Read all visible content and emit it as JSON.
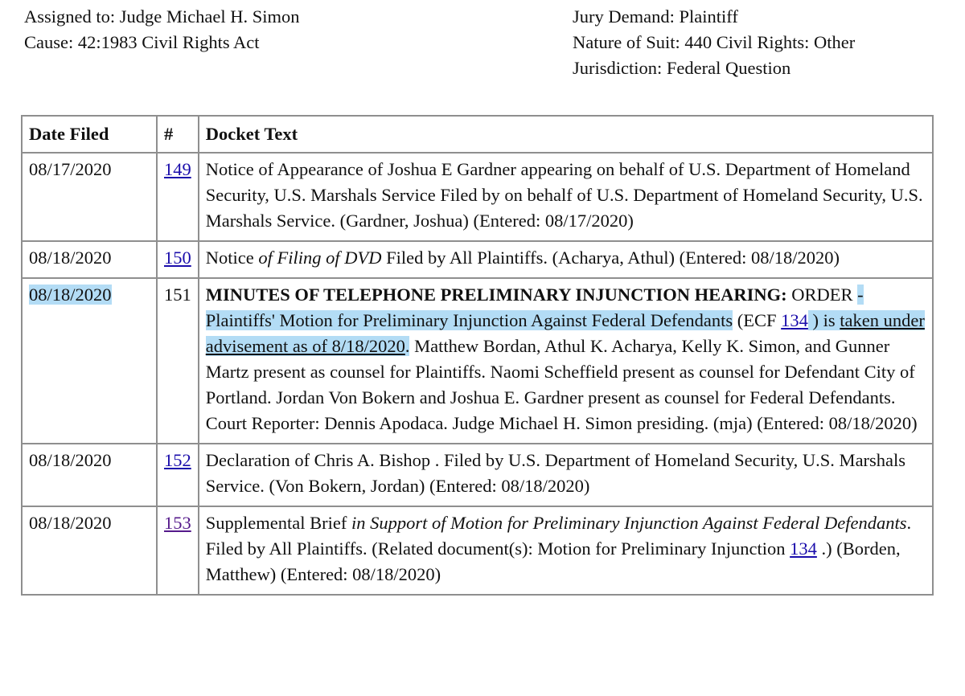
{
  "case_info": {
    "left": [
      "Assigned to: Judge Michael H. Simon",
      "Cause: 42:1983 Civil Rights Act"
    ],
    "right": [
      "Jury Demand: Plaintiff",
      "Nature of Suit: 440 Civil Rights: Other",
      "Jurisdiction: Federal Question"
    ]
  },
  "table": {
    "headers": {
      "date": "Date Filed",
      "number": "#",
      "text": "Docket Text"
    },
    "rows": [
      {
        "date": "08/17/2020",
        "number": "149",
        "number_is_link": true,
        "text": "Notice of Appearance of Joshua E Gardner appearing on behalf of U.S. Department of Homeland Security, U.S. Marshals Service Filed by on behalf of U.S. Department of Homeland Security, U.S. Marshals Service. (Gardner, Joshua) (Entered: 08/17/2020)"
      },
      {
        "date": "08/18/2020",
        "number": "150",
        "number_is_link": true,
        "text_parts": {
          "p1": "Notice ",
          "p2_italic": "of Filing of DVD",
          "p3": " Filed by All Plaintiffs. (Acharya, Athul) (Entered: 08/18/2020)"
        }
      },
      {
        "date": "08/18/2020",
        "date_highlighted": true,
        "number": "151",
        "number_is_link": false,
        "text_parts": {
          "title_bold": "MINUTES OF TELEPHONE PRELIMINARY INJUNCTION HEARING:",
          "order": " ORDER ",
          "hl1": "- Plaintiffs' Motion for Preliminary Injunction Against Federal Defendants",
          "ecf_open": " (ECF ",
          "ecf_link": "134",
          "hl2_pre": " ) is ",
          "hl2_underlined": "taken under advisement as of 8/18/2020",
          "hl2_end": ".",
          "rest": " Matthew Bordan, Athul K. Acharya, Kelly K. Simon, and Gunner Martz present as counsel for Plaintiffs. Naomi Scheffield present as counsel for Defendant City of Portland. Jordan Von Bokern and Joshua E. Gardner present as counsel for Federal Defendants. Court Reporter: Dennis Apodaca. Judge Michael H. Simon presiding. (mja) (Entered: 08/18/2020)"
        }
      },
      {
        "date": "08/18/2020",
        "number": "152",
        "number_is_link": true,
        "text": "Declaration of Chris A. Bishop . Filed by U.S. Department of Homeland Security, U.S. Marshals Service. (Von Bokern, Jordan) (Entered: 08/18/2020)"
      },
      {
        "date": "08/18/2020",
        "number": "153",
        "number_is_link": true,
        "number_visited": true,
        "text_parts": {
          "p1": "Supplemental Brief ",
          "p2_italic": "in Support of Motion for Preliminary Injunction Against Federal Defendants",
          "p3": ". Filed by All Plaintiffs. (Related document(s): Motion for Preliminary Injunction ",
          "link": "134",
          "p4": " .) (Borden, Matthew) (Entered: 08/18/2020)"
        }
      }
    ]
  },
  "colors": {
    "link": "#1a0dab",
    "visited_link": "#551a8b",
    "highlight": "#b3dcf5",
    "border": "#8f8f8f"
  }
}
